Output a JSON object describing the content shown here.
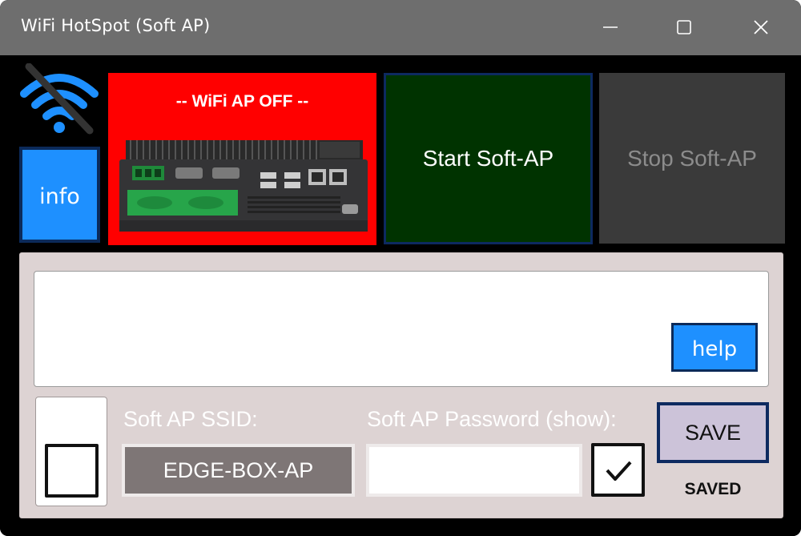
{
  "window": {
    "title": "WiFi HotSpot (Soft AP)"
  },
  "icons": {
    "minimize": "minimize-icon",
    "maximize": "maximize-icon",
    "close": "close-icon",
    "wifi_status": "wifi-off-icon",
    "device": "edge-box-device-image",
    "checkmark": "checkmark-icon"
  },
  "buttons": {
    "info": "info",
    "start": "Start Soft-AP",
    "stop": "Stop Soft-AP",
    "help": "help",
    "save": "SAVE"
  },
  "status": {
    "text": "-- WiFi AP OFF --",
    "saved": "SAVED"
  },
  "config": {
    "ssid_label": "Soft AP SSID:",
    "ssid_value": "EDGE-BOX-AP",
    "password_label": "Soft AP Password (show):",
    "password_value": "",
    "show_password_checked": true,
    "left_checkbox_checked": false
  },
  "log": {
    "text": ""
  },
  "colors": {
    "titlebar": "#6e6e6e",
    "background": "#000000",
    "status_off": "#ff0000",
    "start_button": "#003300",
    "stop_button_disabled": "#3a3a3a",
    "accent_blue": "#1e90ff",
    "panel": "#ddd3d3",
    "wifi_icon": "#1e90ff"
  }
}
